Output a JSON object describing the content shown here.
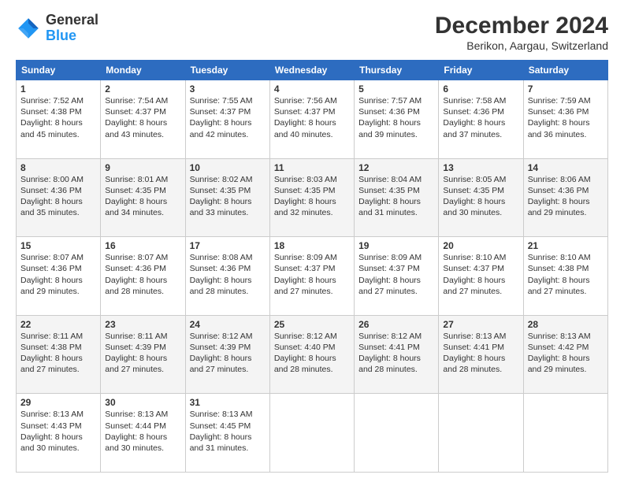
{
  "header": {
    "logo": {
      "line1": "General",
      "line2": "Blue"
    },
    "title": "December 2024",
    "subtitle": "Berikon, Aargau, Switzerland"
  },
  "days_of_week": [
    "Sunday",
    "Monday",
    "Tuesday",
    "Wednesday",
    "Thursday",
    "Friday",
    "Saturday"
  ],
  "weeks": [
    [
      {
        "day": 1,
        "sunrise": "7:52 AM",
        "sunset": "4:38 PM",
        "daylight": "8 hours and 45 minutes."
      },
      {
        "day": 2,
        "sunrise": "7:54 AM",
        "sunset": "4:37 PM",
        "daylight": "8 hours and 43 minutes."
      },
      {
        "day": 3,
        "sunrise": "7:55 AM",
        "sunset": "4:37 PM",
        "daylight": "8 hours and 42 minutes."
      },
      {
        "day": 4,
        "sunrise": "7:56 AM",
        "sunset": "4:37 PM",
        "daylight": "8 hours and 40 minutes."
      },
      {
        "day": 5,
        "sunrise": "7:57 AM",
        "sunset": "4:36 PM",
        "daylight": "8 hours and 39 minutes."
      },
      {
        "day": 6,
        "sunrise": "7:58 AM",
        "sunset": "4:36 PM",
        "daylight": "8 hours and 37 minutes."
      },
      {
        "day": 7,
        "sunrise": "7:59 AM",
        "sunset": "4:36 PM",
        "daylight": "8 hours and 36 minutes."
      }
    ],
    [
      {
        "day": 8,
        "sunrise": "8:00 AM",
        "sunset": "4:36 PM",
        "daylight": "8 hours and 35 minutes."
      },
      {
        "day": 9,
        "sunrise": "8:01 AM",
        "sunset": "4:35 PM",
        "daylight": "8 hours and 34 minutes."
      },
      {
        "day": 10,
        "sunrise": "8:02 AM",
        "sunset": "4:35 PM",
        "daylight": "8 hours and 33 minutes."
      },
      {
        "day": 11,
        "sunrise": "8:03 AM",
        "sunset": "4:35 PM",
        "daylight": "8 hours and 32 minutes."
      },
      {
        "day": 12,
        "sunrise": "8:04 AM",
        "sunset": "4:35 PM",
        "daylight": "8 hours and 31 minutes."
      },
      {
        "day": 13,
        "sunrise": "8:05 AM",
        "sunset": "4:35 PM",
        "daylight": "8 hours and 30 minutes."
      },
      {
        "day": 14,
        "sunrise": "8:06 AM",
        "sunset": "4:36 PM",
        "daylight": "8 hours and 29 minutes."
      }
    ],
    [
      {
        "day": 15,
        "sunrise": "8:07 AM",
        "sunset": "4:36 PM",
        "daylight": "8 hours and 29 minutes."
      },
      {
        "day": 16,
        "sunrise": "8:07 AM",
        "sunset": "4:36 PM",
        "daylight": "8 hours and 28 minutes."
      },
      {
        "day": 17,
        "sunrise": "8:08 AM",
        "sunset": "4:36 PM",
        "daylight": "8 hours and 28 minutes."
      },
      {
        "day": 18,
        "sunrise": "8:09 AM",
        "sunset": "4:37 PM",
        "daylight": "8 hours and 27 minutes."
      },
      {
        "day": 19,
        "sunrise": "8:09 AM",
        "sunset": "4:37 PM",
        "daylight": "8 hours and 27 minutes."
      },
      {
        "day": 20,
        "sunrise": "8:10 AM",
        "sunset": "4:37 PM",
        "daylight": "8 hours and 27 minutes."
      },
      {
        "day": 21,
        "sunrise": "8:10 AM",
        "sunset": "4:38 PM",
        "daylight": "8 hours and 27 minutes."
      }
    ],
    [
      {
        "day": 22,
        "sunrise": "8:11 AM",
        "sunset": "4:38 PM",
        "daylight": "8 hours and 27 minutes."
      },
      {
        "day": 23,
        "sunrise": "8:11 AM",
        "sunset": "4:39 PM",
        "daylight": "8 hours and 27 minutes."
      },
      {
        "day": 24,
        "sunrise": "8:12 AM",
        "sunset": "4:39 PM",
        "daylight": "8 hours and 27 minutes."
      },
      {
        "day": 25,
        "sunrise": "8:12 AM",
        "sunset": "4:40 PM",
        "daylight": "8 hours and 28 minutes."
      },
      {
        "day": 26,
        "sunrise": "8:12 AM",
        "sunset": "4:41 PM",
        "daylight": "8 hours and 28 minutes."
      },
      {
        "day": 27,
        "sunrise": "8:13 AM",
        "sunset": "4:41 PM",
        "daylight": "8 hours and 28 minutes."
      },
      {
        "day": 28,
        "sunrise": "8:13 AM",
        "sunset": "4:42 PM",
        "daylight": "8 hours and 29 minutes."
      }
    ],
    [
      {
        "day": 29,
        "sunrise": "8:13 AM",
        "sunset": "4:43 PM",
        "daylight": "8 hours and 30 minutes."
      },
      {
        "day": 30,
        "sunrise": "8:13 AM",
        "sunset": "4:44 PM",
        "daylight": "8 hours and 30 minutes."
      },
      {
        "day": 31,
        "sunrise": "8:13 AM",
        "sunset": "4:45 PM",
        "daylight": "8 hours and 31 minutes."
      },
      null,
      null,
      null,
      null
    ]
  ],
  "labels": {
    "sunrise": "Sunrise:",
    "sunset": "Sunset:",
    "daylight": "Daylight:"
  }
}
